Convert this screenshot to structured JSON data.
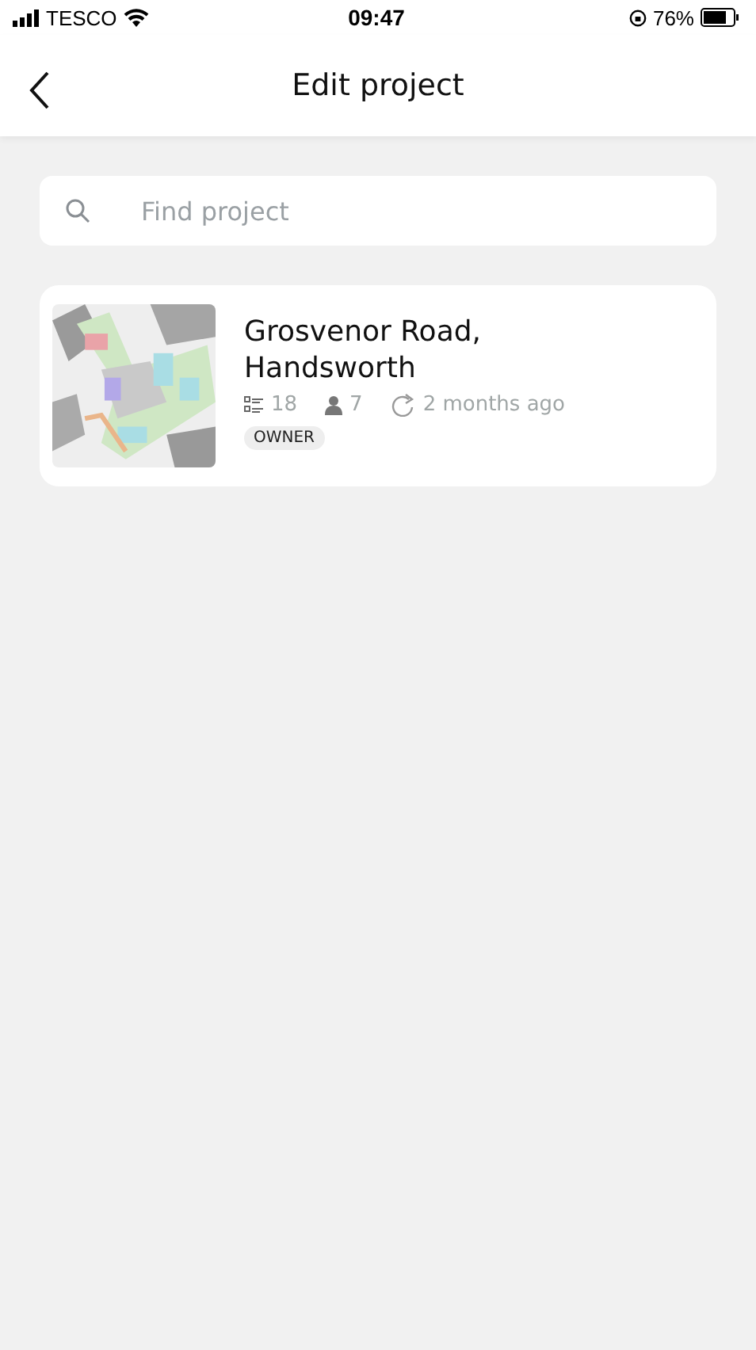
{
  "status_bar": {
    "carrier": "TESCO",
    "time": "09:47",
    "battery": "76%"
  },
  "header": {
    "title": "Edit project"
  },
  "search": {
    "placeholder": "Find project"
  },
  "projects": [
    {
      "name": "Grosvenor Road, Handsworth",
      "tasks": "18",
      "members": "7",
      "updated": "2 months ago",
      "role": "OWNER"
    }
  ]
}
